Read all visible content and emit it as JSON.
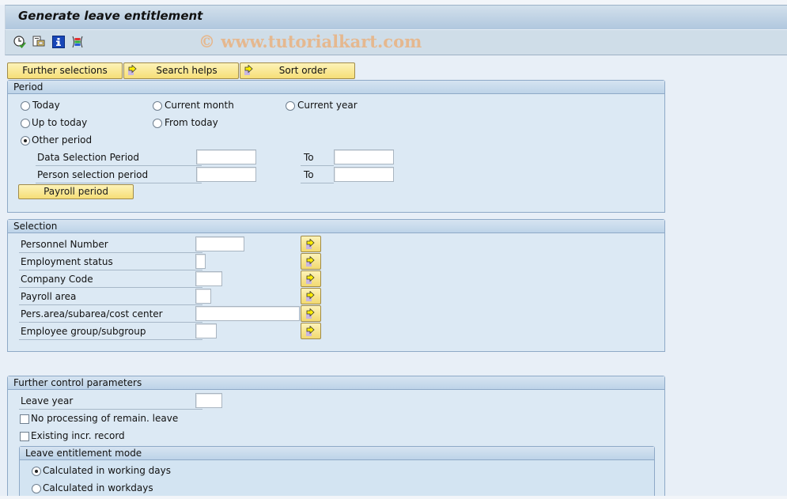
{
  "window": {
    "title": "Generate leave entitlement",
    "watermark": "© www.tutorialkart.com"
  },
  "app_toolbar": {
    "icons": [
      {
        "name": "execute-in-background-icon",
        "tooltip": ""
      },
      {
        "name": "get-variant-icon",
        "tooltip": ""
      },
      {
        "name": "program-documentation-icon",
        "tooltip": ""
      },
      {
        "name": "selection-options-icon",
        "tooltip": ""
      }
    ]
  },
  "nav_buttons": {
    "further_selections": "Further selections",
    "search_helps": "Search helps",
    "sort_order": "Sort order"
  },
  "period": {
    "title": "Period",
    "radios": {
      "today": {
        "label": "Today",
        "selected": false
      },
      "current_month": {
        "label": "Current month",
        "selected": false
      },
      "current_year": {
        "label": "Current year",
        "selected": false
      },
      "up_to_today": {
        "label": "Up to today",
        "selected": false
      },
      "from_today": {
        "label": "From today",
        "selected": false
      },
      "other_period": {
        "label": "Other period",
        "selected": true
      }
    },
    "data_selection_period": {
      "label": "Data Selection Period",
      "from": "",
      "to_label": "To",
      "to": ""
    },
    "person_selection_period": {
      "label": "Person selection period",
      "from": "",
      "to_label": "To",
      "to": ""
    },
    "payroll_period_button": "Payroll period"
  },
  "selection": {
    "title": "Selection",
    "fields": [
      {
        "label": "Personnel Number",
        "value": ""
      },
      {
        "label": "Employment status",
        "value": ""
      },
      {
        "label": "Company Code",
        "value": ""
      },
      {
        "label": "Payroll area",
        "value": ""
      },
      {
        "label": "Pers.area/subarea/cost center",
        "value": ""
      },
      {
        "label": "Employee group/subgroup",
        "value": ""
      }
    ]
  },
  "control": {
    "title": "Further control parameters",
    "leave_year": {
      "label": "Leave year",
      "value": ""
    },
    "no_processing": {
      "label": "No processing of remain. leave",
      "checked": false
    },
    "existing_incr": {
      "label": "Existing incr. record",
      "checked": false
    },
    "mode": {
      "title": "Leave entitlement mode",
      "working_days": {
        "label": "Calculated in working days",
        "selected": true
      },
      "workdays": {
        "label": "Calculated in workdays",
        "selected": false
      }
    }
  }
}
